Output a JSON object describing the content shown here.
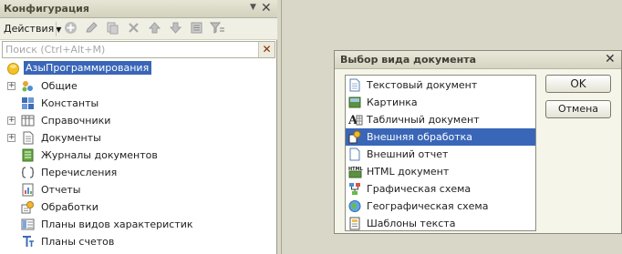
{
  "config_panel": {
    "title": "Конфигурация",
    "pin_icon": "pin-icon",
    "close_label": "✕",
    "toolbar": {
      "actions_label": "Действия",
      "icons": [
        "add-icon",
        "edit-icon",
        "copy-icon",
        "delete-icon",
        "move-up-icon",
        "move-down-icon",
        "list-icon",
        "filter-icon"
      ]
    },
    "search": {
      "placeholder": "Поиск (Ctrl+Alt+M)",
      "clear_label": "✕"
    },
    "tree": {
      "root": {
        "label": "АзыПрограммирования",
        "icon": "configuration-root-icon"
      },
      "items": [
        {
          "label": "Общие",
          "icon": "common-icon",
          "expandable": true
        },
        {
          "label": "Константы",
          "icon": "constants-icon",
          "expandable": false
        },
        {
          "label": "Справочники",
          "icon": "catalogs-icon",
          "expandable": true
        },
        {
          "label": "Документы",
          "icon": "documents-icon",
          "expandable": true
        },
        {
          "label": "Журналы документов",
          "icon": "journals-icon",
          "expandable": false
        },
        {
          "label": "Перечисления",
          "icon": "enumerations-icon",
          "expandable": false
        },
        {
          "label": "Отчеты",
          "icon": "reports-icon",
          "expandable": false
        },
        {
          "label": "Обработки",
          "icon": "data-processors-icon",
          "expandable": false
        },
        {
          "label": "Планы видов характеристик",
          "icon": "characteristic-types-icon",
          "expandable": false
        },
        {
          "label": "Планы счетов",
          "icon": "chart-of-accounts-icon",
          "expandable": false
        }
      ]
    }
  },
  "dialog": {
    "title": "Выбор вида документа",
    "close_label": "✕",
    "items": [
      {
        "label": "Текстовый документ",
        "icon": "text-document-icon",
        "selected": false
      },
      {
        "label": "Картинка",
        "icon": "picture-icon",
        "selected": false
      },
      {
        "label": "Табличный документ",
        "icon": "spreadsheet-document-icon",
        "selected": false
      },
      {
        "label": "Внешняя обработка",
        "icon": "external-processor-icon",
        "selected": true
      },
      {
        "label": "Внешний отчет",
        "icon": "external-report-icon",
        "selected": false
      },
      {
        "label": "HTML документ",
        "icon": "html-document-icon",
        "selected": false
      },
      {
        "label": "Графическая схема",
        "icon": "graphic-scheme-icon",
        "selected": false
      },
      {
        "label": "Географическая схема",
        "icon": "geographic-scheme-icon",
        "selected": false
      },
      {
        "label": "Шаблоны текста",
        "icon": "text-templates-icon",
        "selected": false
      }
    ],
    "ok_label": "OK",
    "cancel_label": "Отмена"
  },
  "colors": {
    "selection": "#3a66b8",
    "workspace": "#d9d8c8",
    "title_bar": "#dcdbc9"
  }
}
